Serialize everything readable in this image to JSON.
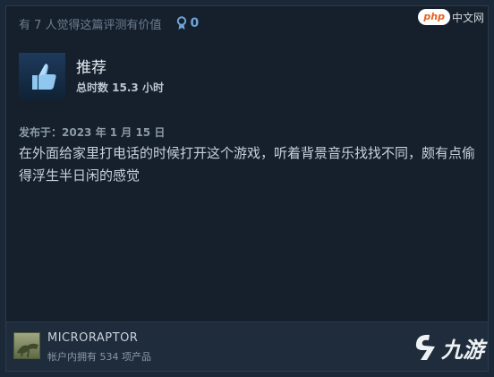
{
  "helpful": {
    "text": "有 7 人觉得这篇评测有价值",
    "award_count": "0",
    "award_icon": "award-ribbon-icon"
  },
  "watermark_top": {
    "pill": "php",
    "cn": "中文网"
  },
  "recommendation": {
    "icon": "thumbs-up-icon",
    "title": "推荐",
    "hours": "总时数 15.3 小时"
  },
  "review": {
    "posted": "发布于：2023 年 1 月 15 日",
    "text": "在外面给家里打电话的时候打开这个游戏，听着背景音乐找找不同，颇有点偷得浮生半日闲的感觉"
  },
  "author": {
    "name": "MICRORAPTOR",
    "owned": "帐户内拥有 534 项产品"
  },
  "watermark_bottom": {
    "text": "九游"
  },
  "colors": {
    "background": "#16202d",
    "accent": "#6ea3d9",
    "footer": "#1f2c3b"
  }
}
